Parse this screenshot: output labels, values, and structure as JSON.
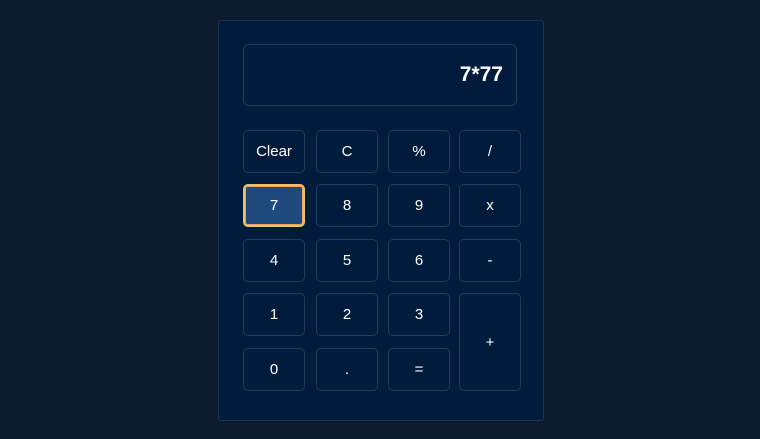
{
  "display": {
    "value": "7*77"
  },
  "keys": {
    "clear": "Clear",
    "c": "C",
    "percent": "%",
    "divide": "/",
    "seven": "7",
    "eight": "8",
    "nine": "9",
    "multiply": "x",
    "four": "4",
    "five": "5",
    "six": "6",
    "minus": "-",
    "one": "1",
    "two": "2",
    "three": "3",
    "plus": "+",
    "zero": "0",
    "dot": ".",
    "equals": "="
  },
  "colors": {
    "page_background": "#0b1a2c",
    "panel_background": "#001b3b",
    "active_key_background": "#1e4a7d",
    "active_key_border": "#e9c46a"
  },
  "state": {
    "focused_key": "7"
  }
}
